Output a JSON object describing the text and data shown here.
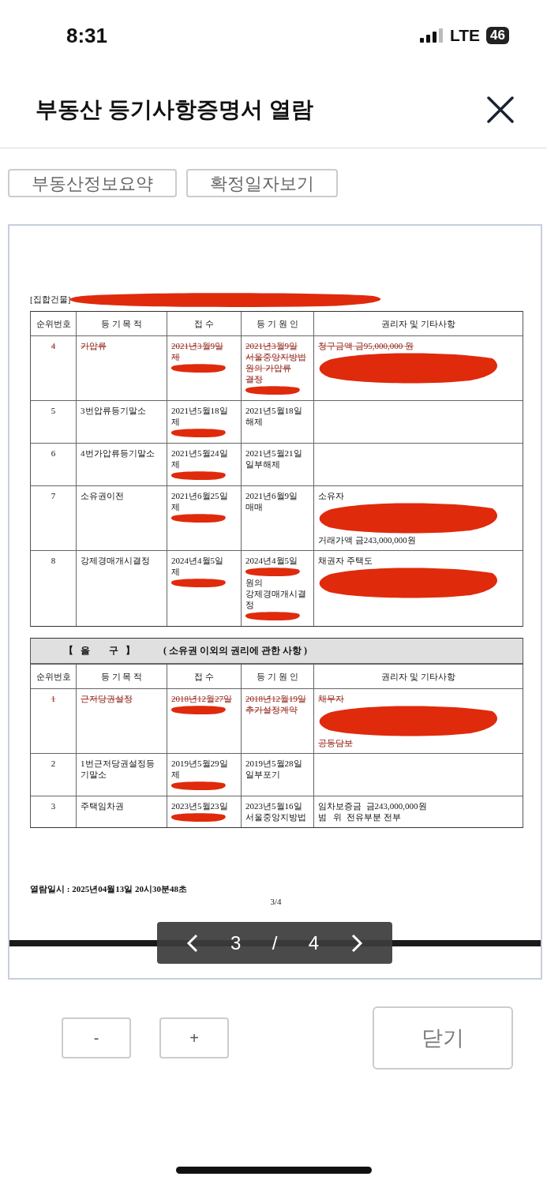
{
  "status_bar": {
    "time": "8:31",
    "network": "LTE",
    "battery": "46"
  },
  "header": {
    "title": "부동산 등기사항증명서 열람"
  },
  "buttons": [
    {
      "label": "부동산정보요약"
    },
    {
      "label": "확정일자보기"
    }
  ],
  "document": {
    "heading": {
      "text": "[집합건물]",
      "redacted": true
    },
    "sections": [
      {
        "columns": [
          "순위번호",
          "등 기 목 적",
          "접 수",
          "등 기 원 인",
          "권리자 및 기타사항"
        ],
        "rows": [
          {
            "cancelled": true,
            "cells": [
              [
                {
                  "kind": "text",
                  "text": "4"
                }
              ],
              [
                {
                  "kind": "text",
                  "text": "가압류"
                }
              ],
              [
                {
                  "kind": "text",
                  "text": "2021년3월9일"
                },
                {
                  "kind": "text",
                  "text": "제"
                },
                {
                  "kind": "redaction"
                }
              ],
              [
                {
                  "kind": "text",
                  "text": "2021년3월9일"
                },
                {
                  "kind": "text",
                  "text": "서울중앙지방법"
                },
                {
                  "kind": "text",
                  "text": "원의 가압류"
                },
                {
                  "kind": "text",
                  "text": "결정"
                },
                {
                  "kind": "redaction"
                }
              ],
              [
                {
                  "kind": "text",
                  "text": "청구금액 금95,000,000 원"
                },
                {
                  "kind": "redaction_large"
                }
              ]
            ]
          },
          {
            "cancelled": false,
            "cells": [
              [
                {
                  "kind": "text",
                  "text": "5"
                }
              ],
              [
                {
                  "kind": "text",
                  "text": "3번압류등기말소"
                }
              ],
              [
                {
                  "kind": "text",
                  "text": "2021년5월18일"
                },
                {
                  "kind": "text",
                  "text": "제"
                },
                {
                  "kind": "redaction"
                }
              ],
              [
                {
                  "kind": "text",
                  "text": "2021년5월18일"
                },
                {
                  "kind": "text",
                  "text": "해제"
                }
              ],
              []
            ]
          },
          {
            "cancelled": false,
            "cells": [
              [
                {
                  "kind": "text",
                  "text": "6"
                }
              ],
              [
                {
                  "kind": "text",
                  "text": "4번가압류등기말소"
                }
              ],
              [
                {
                  "kind": "text",
                  "text": "2021년5월24일"
                },
                {
                  "kind": "text",
                  "text": "제"
                },
                {
                  "kind": "redaction"
                }
              ],
              [
                {
                  "kind": "text",
                  "text": "2021년5월21일"
                },
                {
                  "kind": "text",
                  "text": "일부해제"
                }
              ],
              []
            ]
          },
          {
            "cancelled": false,
            "cells": [
              [
                {
                  "kind": "text",
                  "text": "7"
                }
              ],
              [
                {
                  "kind": "text",
                  "text": "소유권이전"
                }
              ],
              [
                {
                  "kind": "text",
                  "text": "2021년6월25일"
                },
                {
                  "kind": "text",
                  "text": "제"
                },
                {
                  "kind": "redaction"
                }
              ],
              [
                {
                  "kind": "text",
                  "text": "2021년6월9일"
                },
                {
                  "kind": "text",
                  "text": "매매"
                }
              ],
              [
                {
                  "kind": "text",
                  "text": "소유자"
                },
                {
                  "kind": "redaction_large"
                },
                {
                  "kind": "text",
                  "text": "거래가액 금243,000,000원"
                }
              ]
            ]
          },
          {
            "cancelled": false,
            "cells": [
              [
                {
                  "kind": "text",
                  "text": "8"
                }
              ],
              [
                {
                  "kind": "text",
                  "text": "강제경매개시결정"
                }
              ],
              [
                {
                  "kind": "text",
                  "text": "2024년4월5일"
                },
                {
                  "kind": "text",
                  "text": "제"
                },
                {
                  "kind": "redaction"
                }
              ],
              [
                {
                  "kind": "text",
                  "text": "2024년4월5일"
                },
                {
                  "kind": "redaction"
                },
                {
                  "kind": "text",
                  "text": "원의"
                },
                {
                  "kind": "text",
                  "text": "강제경매개시결"
                },
                {
                  "kind": "text",
                  "text": "정"
                },
                {
                  "kind": "redaction"
                }
              ],
              [
                {
                  "kind": "text",
                  "text": "채권자 주택도"
                },
                {
                  "kind": "redaction_large"
                }
              ]
            ]
          }
        ]
      },
      {
        "banner": {
          "title": "【   을        구   】",
          "subtitle": "( 소유권 이외의 권리에 관한 사항 )"
        },
        "columns": [
          "순위번호",
          "등 기 목 적",
          "접 수",
          "등 기 원 인",
          "권리자 및 기타사항"
        ],
        "rows": [
          {
            "cancelled": true,
            "cells": [
              [
                {
                  "kind": "text",
                  "text": "1"
                }
              ],
              [
                {
                  "kind": "text",
                  "text": "근저당권설정"
                }
              ],
              [
                {
                  "kind": "text",
                  "text": "2018년12월27일"
                },
                {
                  "kind": "redaction"
                }
              ],
              [
                {
                  "kind": "text",
                  "text": "2018년12월19일"
                },
                {
                  "kind": "text",
                  "text": "추가설정계약"
                }
              ],
              [
                {
                  "kind": "text",
                  "text": "채무자"
                },
                {
                  "kind": "redaction_large"
                },
                {
                  "kind": "text",
                  "text": "공동담보"
                }
              ]
            ]
          },
          {
            "cancelled": false,
            "cells": [
              [
                {
                  "kind": "text",
                  "text": "2"
                }
              ],
              [
                {
                  "kind": "text",
                  "text": "1번근저당권설정등"
                },
                {
                  "kind": "text",
                  "text": "기말소"
                }
              ],
              [
                {
                  "kind": "text",
                  "text": "2019년5월29일"
                },
                {
                  "kind": "text",
                  "text": "제"
                },
                {
                  "kind": "redaction"
                }
              ],
              [
                {
                  "kind": "text",
                  "text": "2019년5월28일"
                },
                {
                  "kind": "text",
                  "text": "일부포기"
                }
              ],
              []
            ]
          },
          {
            "cancelled": false,
            "cells": [
              [
                {
                  "kind": "text",
                  "text": "3"
                }
              ],
              [
                {
                  "kind": "text",
                  "text": "주택임차권"
                }
              ],
              [
                {
                  "kind": "text",
                  "text": "2023년5월23일"
                },
                {
                  "kind": "redaction"
                }
              ],
              [
                {
                  "kind": "text",
                  "text": "2023년5월16일"
                },
                {
                  "kind": "text",
                  "text": "서울중앙지방법"
                }
              ],
              [
                {
                  "kind": "text",
                  "text": "임차보증금  금243,000,000원"
                },
                {
                  "kind": "text",
                  "text": "범   위  전유부분 전부"
                }
              ]
            ]
          }
        ]
      }
    ],
    "footer": {
      "viewed_at": "열람일시 : 2025년04월13일 20시30분48초",
      "page": "3/4"
    }
  },
  "pager": {
    "current": "3",
    "separator": "/",
    "total": "4"
  },
  "zoom_buttons": [
    {
      "label": "-"
    },
    {
      "label": "+"
    }
  ],
  "close_button": {
    "label": "닫기"
  }
}
